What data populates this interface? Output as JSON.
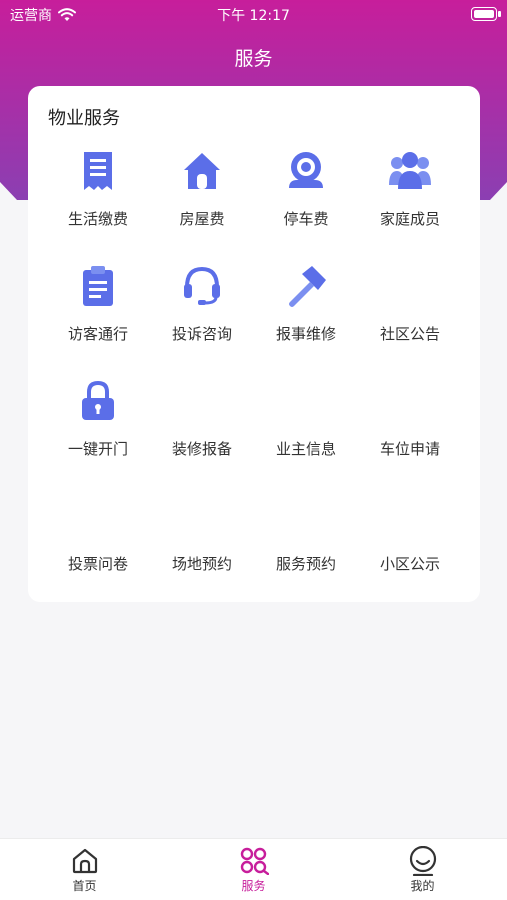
{
  "status_bar": {
    "carrier": "运营商",
    "time": "下午 12:17"
  },
  "nav": {
    "title": "服务"
  },
  "property_section": {
    "title": "物业服务",
    "items": [
      {
        "label": "生活缴费",
        "icon": "bill-icon"
      },
      {
        "label": "房屋费",
        "icon": "house-icon"
      },
      {
        "label": "停车费",
        "icon": "camera-icon"
      },
      {
        "label": "家庭成员",
        "icon": "family-icon"
      },
      {
        "label": "访客通行",
        "icon": "clipboard-icon"
      },
      {
        "label": "投诉咨询",
        "icon": "headset-icon"
      },
      {
        "label": "报事维修",
        "icon": "hammer-icon"
      },
      {
        "label": "社区公告",
        "icon": ""
      },
      {
        "label": "一键开门",
        "icon": "lock-icon"
      },
      {
        "label": "装修报备",
        "icon": ""
      },
      {
        "label": "业主信息",
        "icon": ""
      },
      {
        "label": "车位申请",
        "icon": ""
      },
      {
        "label": "投票问卷",
        "icon": ""
      },
      {
        "label": "场地预约",
        "icon": ""
      },
      {
        "label": "服务预约",
        "icon": ""
      },
      {
        "label": "小区公示",
        "icon": ""
      }
    ]
  },
  "tabbar": {
    "items": [
      {
        "label": "首页",
        "icon": "home-icon",
        "active": false
      },
      {
        "label": "服务",
        "icon": "services-icon",
        "active": true
      },
      {
        "label": "我的",
        "icon": "profile-icon",
        "active": false
      }
    ]
  },
  "colors": {
    "brand": "#c71e9b",
    "brand_dark": "#8b3fb2",
    "icon_blue": "#5b6ee8"
  }
}
